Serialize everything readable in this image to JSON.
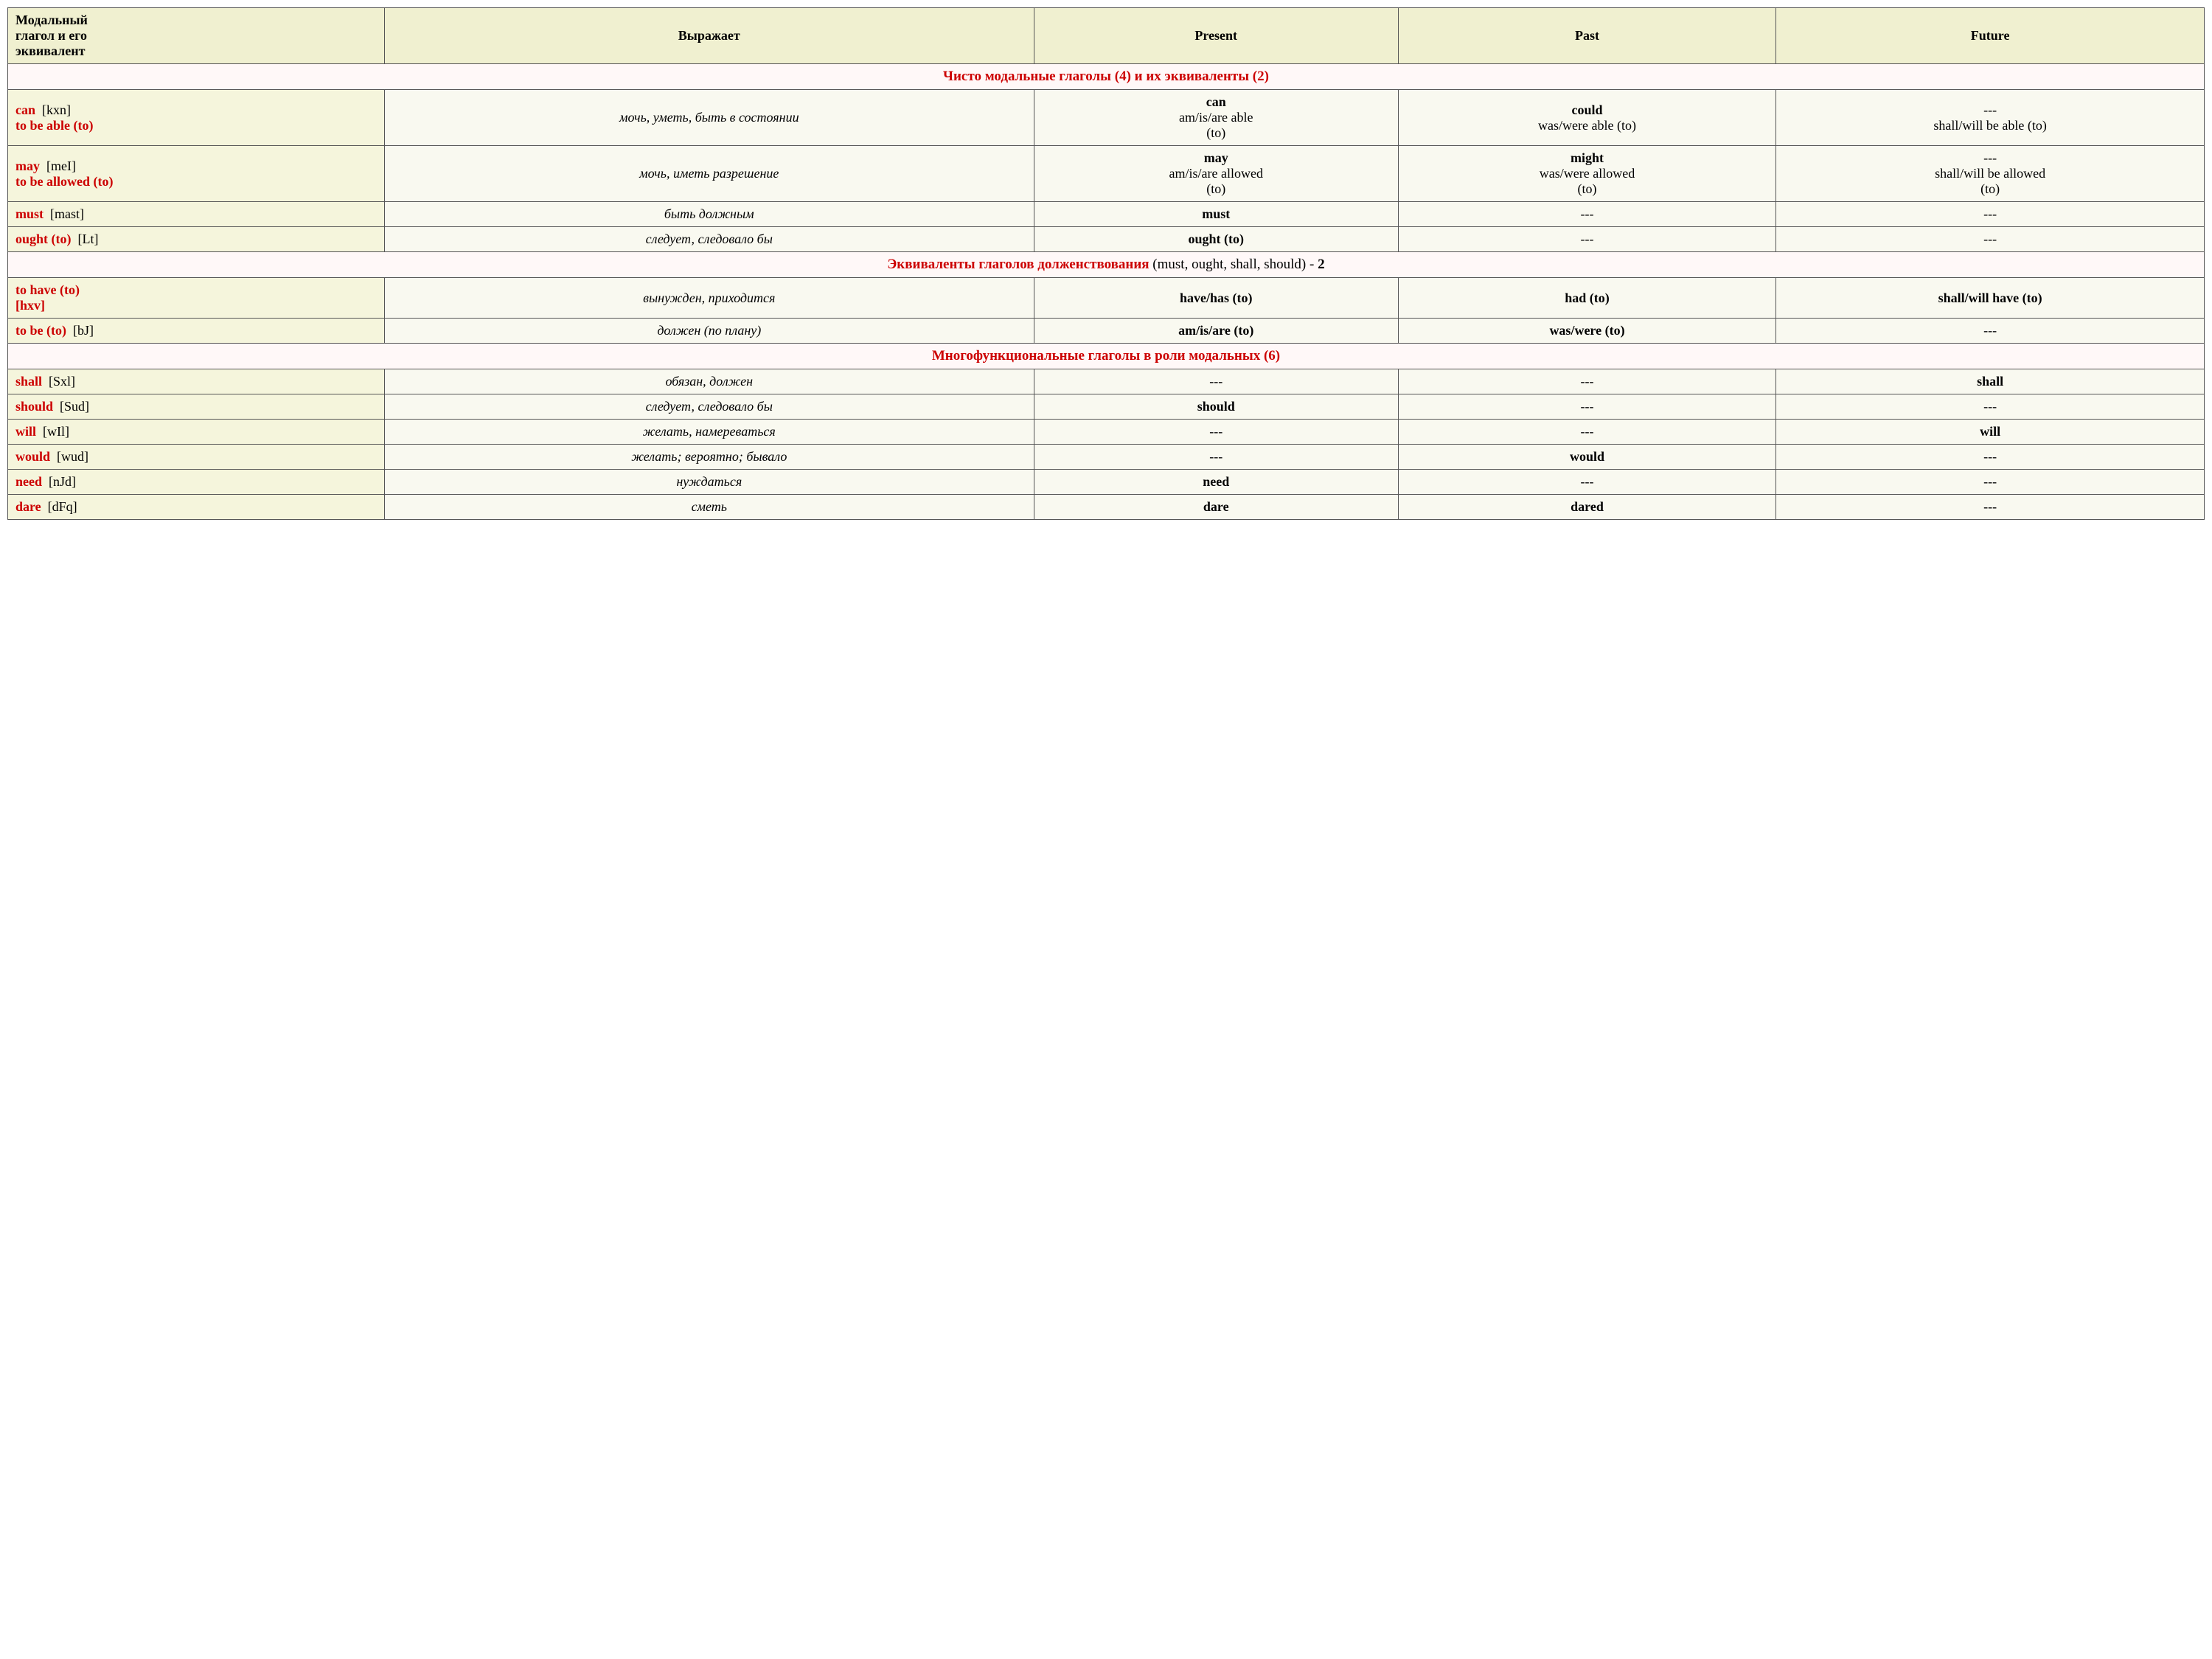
{
  "table": {
    "headers": [
      "Модальный глагол и его эквивалент",
      "Выражает",
      "Present",
      "Past",
      "Future"
    ],
    "sections": [
      {
        "type": "section-header",
        "text_red": "Чисто модальные глаголы (4) и их эквиваленты (2)",
        "text_black": ""
      },
      {
        "type": "data",
        "verb": "can  [kxn]",
        "verb_extra": "to be able (to)",
        "meaning": "мочь, уметь, быть в состоянии",
        "present": "can\nam/is/are able (to)",
        "past": "could\nwas/were able (to)",
        "future": "---\nshall/will be able (to)"
      },
      {
        "type": "data",
        "verb": "may  [meI]",
        "verb_extra": "to be allowed (to)",
        "meaning": "мочь, иметь разрешение",
        "present": "may\nam/is/are allowed (to)",
        "past": "might\nwas/were allowed (to)",
        "future": "---\nshall/will be allowed (to)"
      },
      {
        "type": "data",
        "verb": "must  [mast]",
        "verb_extra": "",
        "meaning": "быть должным",
        "present": "must",
        "past": "---",
        "future": "---"
      },
      {
        "type": "data",
        "verb": "ought (to)  [Lt]",
        "verb_extra": "",
        "meaning": "следует, следовало бы",
        "present": "ought (to)",
        "past": "---",
        "future": "---"
      },
      {
        "type": "section-header",
        "text_red": "Эквиваленты глаголов долженствования",
        "text_black": " (must, ought, shall, should) - 2"
      },
      {
        "type": "data",
        "verb": "to have (to)\n[hxv]",
        "verb_extra": "",
        "meaning": "вынужден, приходится",
        "present": "have/has (to)",
        "past": "had (to)",
        "future": "shall/will have (to)"
      },
      {
        "type": "data",
        "verb": "to be (to)  [bJ]",
        "verb_extra": "",
        "meaning": "должен (по плану)",
        "present": "am/is/are (to)",
        "past": "was/were (to)",
        "future": "---"
      },
      {
        "type": "section-header",
        "text_red": "Многофункциональные глаголы в роли модальных (6)",
        "text_black": ""
      },
      {
        "type": "data",
        "verb": "shall  [Sxl]",
        "verb_extra": "",
        "meaning": "обязан, должен",
        "present": "---",
        "past": "---",
        "future": "shall"
      },
      {
        "type": "data",
        "verb": "should  [Sud]",
        "verb_extra": "",
        "meaning": "следует, следовало бы",
        "present": "should",
        "past": "---",
        "future": "---"
      },
      {
        "type": "data",
        "verb": "will  [wIl]",
        "verb_extra": "",
        "meaning": "желать, намереваться",
        "present": "---",
        "past": "---",
        "future": "will"
      },
      {
        "type": "data",
        "verb": "would  [wud]",
        "verb_extra": "",
        "meaning": "желать; вероятно; бывало",
        "present": "---",
        "past": "would",
        "future": "---"
      },
      {
        "type": "data",
        "verb": "need  [nJd]",
        "verb_extra": "",
        "meaning": "нуждаться",
        "present": "need",
        "past": "---",
        "future": "---"
      },
      {
        "type": "data",
        "verb": "dare  [dFq]",
        "verb_extra": "",
        "meaning": "сметь",
        "present": "dare",
        "past": "dared",
        "future": "---"
      }
    ]
  }
}
